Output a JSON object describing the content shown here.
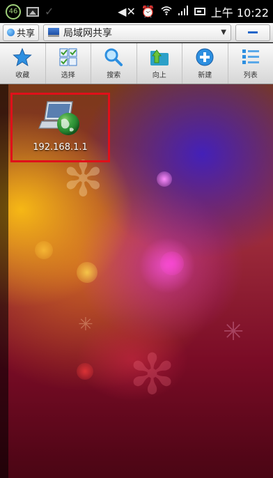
{
  "status_bar": {
    "badge": "46",
    "time": "上午 10:22",
    "icons": [
      "image-icon",
      "check-icon",
      "mute-icon",
      "alarm-icon",
      "wifi-icon",
      "signal-icon",
      "battery-icon"
    ]
  },
  "path_bar": {
    "share_label": "共享",
    "location_label": "局域网共享"
  },
  "toolbar": {
    "items": [
      {
        "label": "收藏",
        "icon": "star-icon"
      },
      {
        "label": "选择",
        "icon": "select-icon"
      },
      {
        "label": "搜索",
        "icon": "search-icon"
      },
      {
        "label": "向上",
        "icon": "up-folder-icon"
      },
      {
        "label": "新建",
        "icon": "add-icon"
      },
      {
        "label": "列表",
        "icon": "list-icon"
      }
    ]
  },
  "items": [
    {
      "label": "192.168.1.1",
      "icon": "network-laptop-icon"
    }
  ],
  "colors": {
    "highlight_border": "#e0101a",
    "accent_blue": "#2466c9"
  }
}
